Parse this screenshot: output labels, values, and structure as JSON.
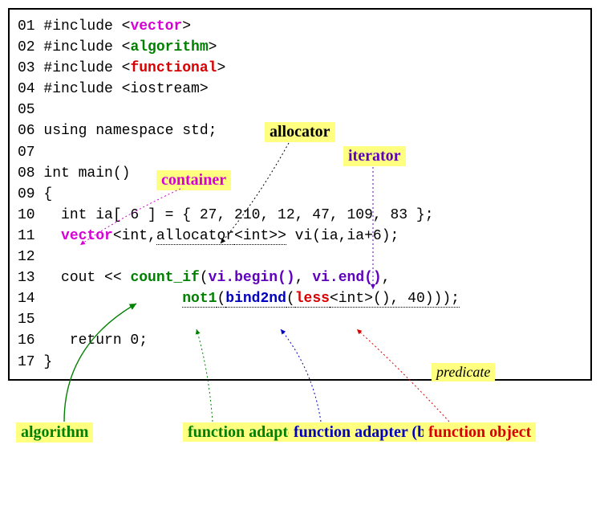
{
  "code": {
    "l01": {
      "num": "01",
      "pre": " #include <",
      "kw": "vector",
      "post": ">"
    },
    "l02": {
      "num": "02",
      "pre": " #include <",
      "kw": "algorithm",
      "post": ">"
    },
    "l03": {
      "num": "03",
      "pre": " #include <",
      "kw": "functional",
      "post": ">"
    },
    "l04": {
      "num": "04",
      "text": " #include <iostream>"
    },
    "l05": {
      "num": "05",
      "text": ""
    },
    "l06": {
      "num": "06",
      "text": " using namespace std;"
    },
    "l07": {
      "num": "07",
      "text": ""
    },
    "l08": {
      "num": "08",
      "text": " int main()"
    },
    "l09": {
      "num": "09",
      "text": " {"
    },
    "l10": {
      "num": "10",
      "text": "   int ia[ 6 ] = { 27, 210, 12, 47, 109, 83 };"
    },
    "l11": {
      "num": "11",
      "pre": "   ",
      "vec": "vector",
      "mid1": "<int,",
      "alloc": "allocator",
      "mid2": "<int>>",
      "rest": " vi(ia,ia+6);"
    },
    "l12": {
      "num": "12",
      "text": ""
    },
    "l13": {
      "num": "13",
      "pre": "   cout << ",
      "cnt": "count_if",
      "open": "(",
      "b": "vi.begin()",
      "c": ", ",
      "e": "vi.end()",
      "d": ","
    },
    "l14": {
      "num": "14",
      "pre": "                 ",
      "not1": "not1",
      "o1": "(",
      "bind": "bind2nd",
      "o2": "(",
      "less": "less",
      "rest": "<int>(), 40)));"
    },
    "l15": {
      "num": "15",
      "text": ""
    },
    "l16": {
      "num": "16",
      "text": "    return 0;"
    },
    "l17": {
      "num": "17",
      "text": " }"
    }
  },
  "labels": {
    "allocator": "allocator",
    "iterator": "iterator",
    "container": "container",
    "predicate": "predicate",
    "algorithm": "algorithm",
    "negator": "function\nadapter\n(negator)",
    "binder": "function\nadapter\n(binder)",
    "funcobj": "function\nobject"
  }
}
